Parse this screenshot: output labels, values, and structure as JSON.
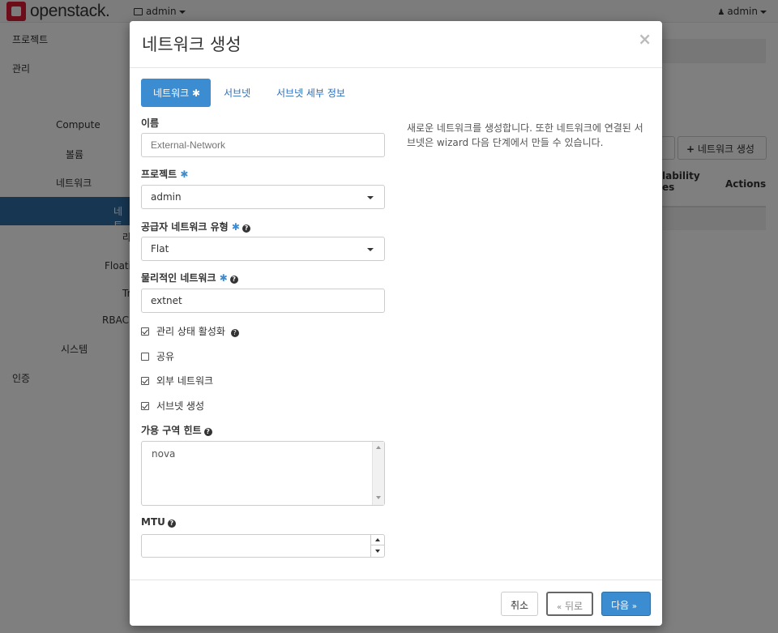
{
  "topbar": {
    "logo_text": "openstack.",
    "project_picker": "admin",
    "user_menu": "admin"
  },
  "sidebar": {
    "items": [
      "프로젝트",
      "관리",
      "Compute",
      "볼륨",
      "네트워크",
      "네트",
      "라",
      "Floati",
      "Tr",
      "RBAC",
      "시스템",
      "인증"
    ]
  },
  "background": {
    "create_network_button": "네트워크 생성",
    "column_availability": "lability",
    "column_availability_2": "es",
    "column_actions": "Actions"
  },
  "modal": {
    "title": "네트워크 생성",
    "close_symbol": "×",
    "tabs": [
      {
        "label": "네트워크",
        "required": true
      },
      {
        "label": "서브넷",
        "required": false
      },
      {
        "label": "서브넷 세부 정보",
        "required": false
      }
    ],
    "fields": {
      "name": {
        "label": "이름",
        "placeholder": "External-Network"
      },
      "project": {
        "label": "프로젝트",
        "value": "admin"
      },
      "provider_network_type": {
        "label": "공급자 네트워크 유형",
        "value": "Flat"
      },
      "physical_network": {
        "label": "물리적인 네트워크",
        "value": "extnet"
      },
      "admin_state": {
        "label": "관리 상태 활성화",
        "checked": true
      },
      "shared": {
        "label": "공유",
        "checked": false
      },
      "external_network": {
        "label": "외부 네트워크",
        "checked": true
      },
      "create_subnet": {
        "label": "서브넷 생성",
        "checked": true
      },
      "availability_zone_hints": {
        "label": "가용 구역 힌트",
        "value": "nova"
      },
      "mtu": {
        "label": "MTU",
        "value": ""
      }
    },
    "required_marker": "✱",
    "help_text": "새로운 네트워크를 생성합니다. 또한 네트워크에 연결된 서브넷은 wizard 다음 단계에서 만들 수 있습니다.",
    "footer": {
      "cancel": "취소",
      "back": "뒤로",
      "next": "다음"
    }
  }
}
